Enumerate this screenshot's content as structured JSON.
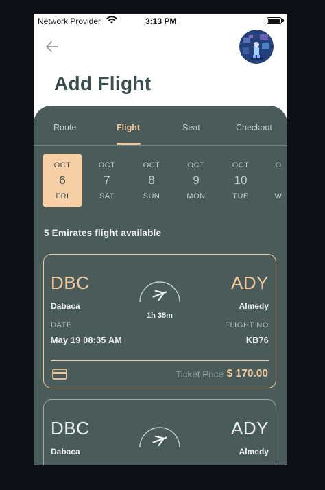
{
  "status_bar": {
    "carrier": "Network Provider",
    "time": "3:13 PM"
  },
  "header": {
    "title": "Add Flight",
    "back_icon": "arrow-left-icon"
  },
  "tabs": [
    {
      "label": "Route",
      "active": false
    },
    {
      "label": "Flight",
      "active": true
    },
    {
      "label": "Seat",
      "active": false
    },
    {
      "label": "Checkout",
      "active": false
    }
  ],
  "dates": [
    {
      "month": "OCT",
      "day": "6",
      "weekday": "FRI",
      "selected": true
    },
    {
      "month": "OCT",
      "day": "7",
      "weekday": "SAT",
      "selected": false
    },
    {
      "month": "OCT",
      "day": "8",
      "weekday": "SUN",
      "selected": false
    },
    {
      "month": "OCT",
      "day": "9",
      "weekday": "MON",
      "selected": false
    },
    {
      "month": "OCT",
      "day": "10",
      "weekday": "TUE",
      "selected": false
    },
    {
      "month": "O",
      "day": "",
      "weekday": "W",
      "selected": false
    }
  ],
  "available_text": "5 Emirates flight available",
  "flights": [
    {
      "from_code": "DBC",
      "from_city": "Dabaca",
      "to_code": "ADY",
      "to_city": "Almedy",
      "duration": "1h 35m",
      "date_label": "DATE",
      "date_value": "May 19 08:35 AM",
      "flight_label": "FLIGHT NO",
      "flight_value": "KB76",
      "price_label": "Ticket Price",
      "price": "$ 170.00"
    },
    {
      "from_code": "DBC",
      "from_city": "Dabaca",
      "to_code": "ADY",
      "to_city": "Almedy"
    }
  ],
  "colors": {
    "panel": "#495b5a",
    "accent": "#f3c99c",
    "title": "#3b4e4e",
    "background": "#0d1117"
  }
}
